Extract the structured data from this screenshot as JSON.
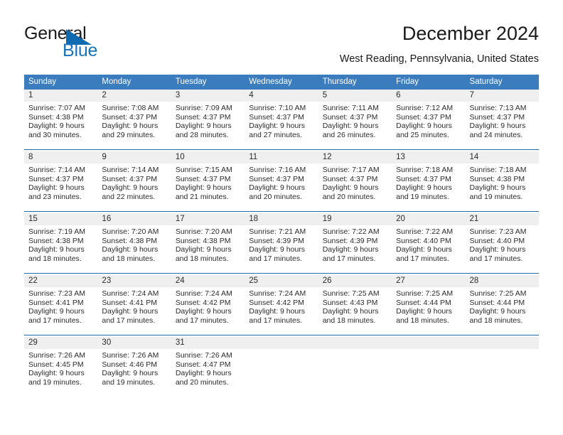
{
  "brand": {
    "word_one": "General",
    "word_two": "Blue",
    "triangle_icon": "triangle-icon",
    "accent_color": "#1774bc"
  },
  "header": {
    "title": "December 2024",
    "location": "West Reading, Pennsylvania, United States"
  },
  "theme": {
    "header_blue": "#3b7cbf",
    "rule_blue": "#1f6cb0",
    "daynum_band": "#efefef"
  },
  "weekdays": [
    "Sunday",
    "Monday",
    "Tuesday",
    "Wednesday",
    "Thursday",
    "Friday",
    "Saturday"
  ],
  "weeks": [
    [
      {
        "day": "1",
        "sunrise": "Sunrise: 7:07 AM",
        "sunset": "Sunset: 4:38 PM",
        "daylight_1": "Daylight: 9 hours",
        "daylight_2": "and 30 minutes."
      },
      {
        "day": "2",
        "sunrise": "Sunrise: 7:08 AM",
        "sunset": "Sunset: 4:37 PM",
        "daylight_1": "Daylight: 9 hours",
        "daylight_2": "and 29 minutes."
      },
      {
        "day": "3",
        "sunrise": "Sunrise: 7:09 AM",
        "sunset": "Sunset: 4:37 PM",
        "daylight_1": "Daylight: 9 hours",
        "daylight_2": "and 28 minutes."
      },
      {
        "day": "4",
        "sunrise": "Sunrise: 7:10 AM",
        "sunset": "Sunset: 4:37 PM",
        "daylight_1": "Daylight: 9 hours",
        "daylight_2": "and 27 minutes."
      },
      {
        "day": "5",
        "sunrise": "Sunrise: 7:11 AM",
        "sunset": "Sunset: 4:37 PM",
        "daylight_1": "Daylight: 9 hours",
        "daylight_2": "and 26 minutes."
      },
      {
        "day": "6",
        "sunrise": "Sunrise: 7:12 AM",
        "sunset": "Sunset: 4:37 PM",
        "daylight_1": "Daylight: 9 hours",
        "daylight_2": "and 25 minutes."
      },
      {
        "day": "7",
        "sunrise": "Sunrise: 7:13 AM",
        "sunset": "Sunset: 4:37 PM",
        "daylight_1": "Daylight: 9 hours",
        "daylight_2": "and 24 minutes."
      }
    ],
    [
      {
        "day": "8",
        "sunrise": "Sunrise: 7:14 AM",
        "sunset": "Sunset: 4:37 PM",
        "daylight_1": "Daylight: 9 hours",
        "daylight_2": "and 23 minutes."
      },
      {
        "day": "9",
        "sunrise": "Sunrise: 7:14 AM",
        "sunset": "Sunset: 4:37 PM",
        "daylight_1": "Daylight: 9 hours",
        "daylight_2": "and 22 minutes."
      },
      {
        "day": "10",
        "sunrise": "Sunrise: 7:15 AM",
        "sunset": "Sunset: 4:37 PM",
        "daylight_1": "Daylight: 9 hours",
        "daylight_2": "and 21 minutes."
      },
      {
        "day": "11",
        "sunrise": "Sunrise: 7:16 AM",
        "sunset": "Sunset: 4:37 PM",
        "daylight_1": "Daylight: 9 hours",
        "daylight_2": "and 20 minutes."
      },
      {
        "day": "12",
        "sunrise": "Sunrise: 7:17 AM",
        "sunset": "Sunset: 4:37 PM",
        "daylight_1": "Daylight: 9 hours",
        "daylight_2": "and 20 minutes."
      },
      {
        "day": "13",
        "sunrise": "Sunrise: 7:18 AM",
        "sunset": "Sunset: 4:37 PM",
        "daylight_1": "Daylight: 9 hours",
        "daylight_2": "and 19 minutes."
      },
      {
        "day": "14",
        "sunrise": "Sunrise: 7:18 AM",
        "sunset": "Sunset: 4:38 PM",
        "daylight_1": "Daylight: 9 hours",
        "daylight_2": "and 19 minutes."
      }
    ],
    [
      {
        "day": "15",
        "sunrise": "Sunrise: 7:19 AM",
        "sunset": "Sunset: 4:38 PM",
        "daylight_1": "Daylight: 9 hours",
        "daylight_2": "and 18 minutes."
      },
      {
        "day": "16",
        "sunrise": "Sunrise: 7:20 AM",
        "sunset": "Sunset: 4:38 PM",
        "daylight_1": "Daylight: 9 hours",
        "daylight_2": "and 18 minutes."
      },
      {
        "day": "17",
        "sunrise": "Sunrise: 7:20 AM",
        "sunset": "Sunset: 4:38 PM",
        "daylight_1": "Daylight: 9 hours",
        "daylight_2": "and 18 minutes."
      },
      {
        "day": "18",
        "sunrise": "Sunrise: 7:21 AM",
        "sunset": "Sunset: 4:39 PM",
        "daylight_1": "Daylight: 9 hours",
        "daylight_2": "and 17 minutes."
      },
      {
        "day": "19",
        "sunrise": "Sunrise: 7:22 AM",
        "sunset": "Sunset: 4:39 PM",
        "daylight_1": "Daylight: 9 hours",
        "daylight_2": "and 17 minutes."
      },
      {
        "day": "20",
        "sunrise": "Sunrise: 7:22 AM",
        "sunset": "Sunset: 4:40 PM",
        "daylight_1": "Daylight: 9 hours",
        "daylight_2": "and 17 minutes."
      },
      {
        "day": "21",
        "sunrise": "Sunrise: 7:23 AM",
        "sunset": "Sunset: 4:40 PM",
        "daylight_1": "Daylight: 9 hours",
        "daylight_2": "and 17 minutes."
      }
    ],
    [
      {
        "day": "22",
        "sunrise": "Sunrise: 7:23 AM",
        "sunset": "Sunset: 4:41 PM",
        "daylight_1": "Daylight: 9 hours",
        "daylight_2": "and 17 minutes."
      },
      {
        "day": "23",
        "sunrise": "Sunrise: 7:24 AM",
        "sunset": "Sunset: 4:41 PM",
        "daylight_1": "Daylight: 9 hours",
        "daylight_2": "and 17 minutes."
      },
      {
        "day": "24",
        "sunrise": "Sunrise: 7:24 AM",
        "sunset": "Sunset: 4:42 PM",
        "daylight_1": "Daylight: 9 hours",
        "daylight_2": "and 17 minutes."
      },
      {
        "day": "25",
        "sunrise": "Sunrise: 7:24 AM",
        "sunset": "Sunset: 4:42 PM",
        "daylight_1": "Daylight: 9 hours",
        "daylight_2": "and 17 minutes."
      },
      {
        "day": "26",
        "sunrise": "Sunrise: 7:25 AM",
        "sunset": "Sunset: 4:43 PM",
        "daylight_1": "Daylight: 9 hours",
        "daylight_2": "and 18 minutes."
      },
      {
        "day": "27",
        "sunrise": "Sunrise: 7:25 AM",
        "sunset": "Sunset: 4:44 PM",
        "daylight_1": "Daylight: 9 hours",
        "daylight_2": "and 18 minutes."
      },
      {
        "day": "28",
        "sunrise": "Sunrise: 7:25 AM",
        "sunset": "Sunset: 4:44 PM",
        "daylight_1": "Daylight: 9 hours",
        "daylight_2": "and 18 minutes."
      }
    ],
    [
      {
        "day": "29",
        "sunrise": "Sunrise: 7:26 AM",
        "sunset": "Sunset: 4:45 PM",
        "daylight_1": "Daylight: 9 hours",
        "daylight_2": "and 19 minutes."
      },
      {
        "day": "30",
        "sunrise": "Sunrise: 7:26 AM",
        "sunset": "Sunset: 4:46 PM",
        "daylight_1": "Daylight: 9 hours",
        "daylight_2": "and 19 minutes."
      },
      {
        "day": "31",
        "sunrise": "Sunrise: 7:26 AM",
        "sunset": "Sunset: 4:47 PM",
        "daylight_1": "Daylight: 9 hours",
        "daylight_2": "and 20 minutes."
      },
      {
        "day": "",
        "sunrise": "",
        "sunset": "",
        "daylight_1": "",
        "daylight_2": ""
      },
      {
        "day": "",
        "sunrise": "",
        "sunset": "",
        "daylight_1": "",
        "daylight_2": ""
      },
      {
        "day": "",
        "sunrise": "",
        "sunset": "",
        "daylight_1": "",
        "daylight_2": ""
      },
      {
        "day": "",
        "sunrise": "",
        "sunset": "",
        "daylight_1": "",
        "daylight_2": ""
      }
    ]
  ]
}
